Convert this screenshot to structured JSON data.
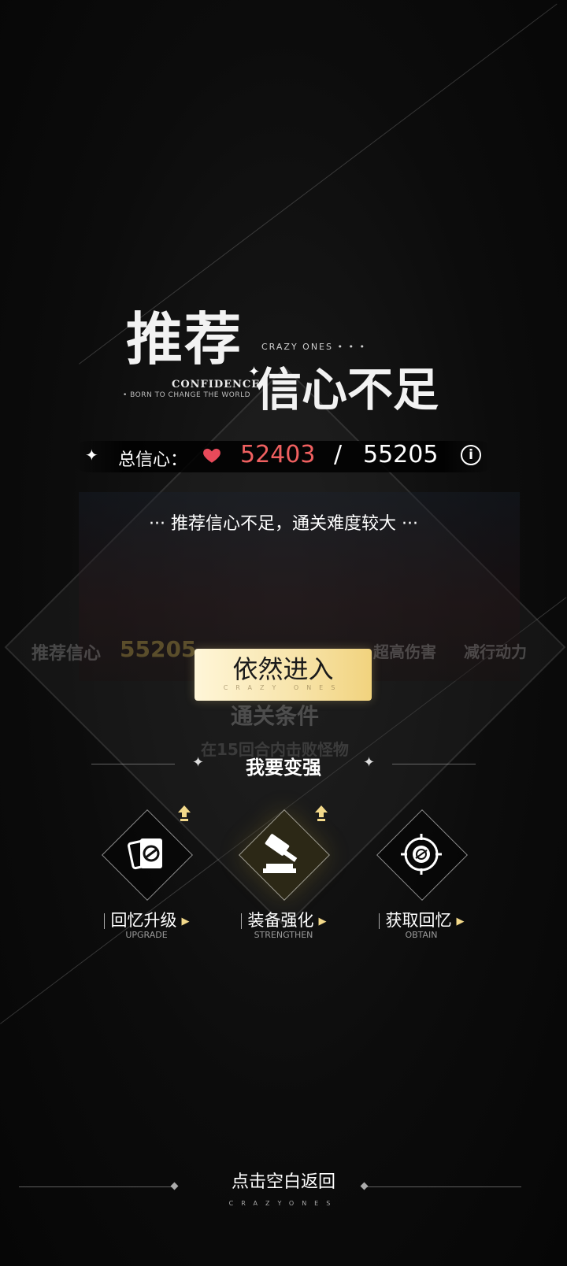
{
  "title": {
    "line1": "推荐",
    "line2": "信心不足",
    "crazy_ones": "CRAZY ONES • • •",
    "confidence": "CONFIDENCE",
    "born": "• BORN TO CHANGE THE WORLD"
  },
  "stats": {
    "label": "总信心：",
    "current": "52403",
    "separator": "/",
    "required": "55205",
    "info_icon": "info-icon",
    "current_color": "#f06060"
  },
  "warning": "··· 推荐信心不足，通关难度较大 ···",
  "background_panel": {
    "recommend_label": "推荐信心",
    "recommend_value": "55205",
    "tag1": "超高伤害",
    "tag2": "减行动力",
    "clear_title": "通关条件",
    "clear_desc": "在15回合内击败怪物"
  },
  "enter_button": {
    "label": "依然进入",
    "sub": "CRAZY ONES"
  },
  "strengthen": {
    "title": "我要变强",
    "items": [
      {
        "label": "回忆升级",
        "en": "UPGRADE",
        "icon": "memory-card-icon"
      },
      {
        "label": "装备强化",
        "en": "STRENGTHEN",
        "icon": "hammer-icon"
      },
      {
        "label": "获取回忆",
        "en": "OBTAIN",
        "icon": "target-icon"
      }
    ]
  },
  "footer": {
    "return": "点击空白返回",
    "sub": "CRAZYONES"
  },
  "colors": {
    "accent_gold": "#f7e3a8",
    "heart": "#e84a5a"
  }
}
